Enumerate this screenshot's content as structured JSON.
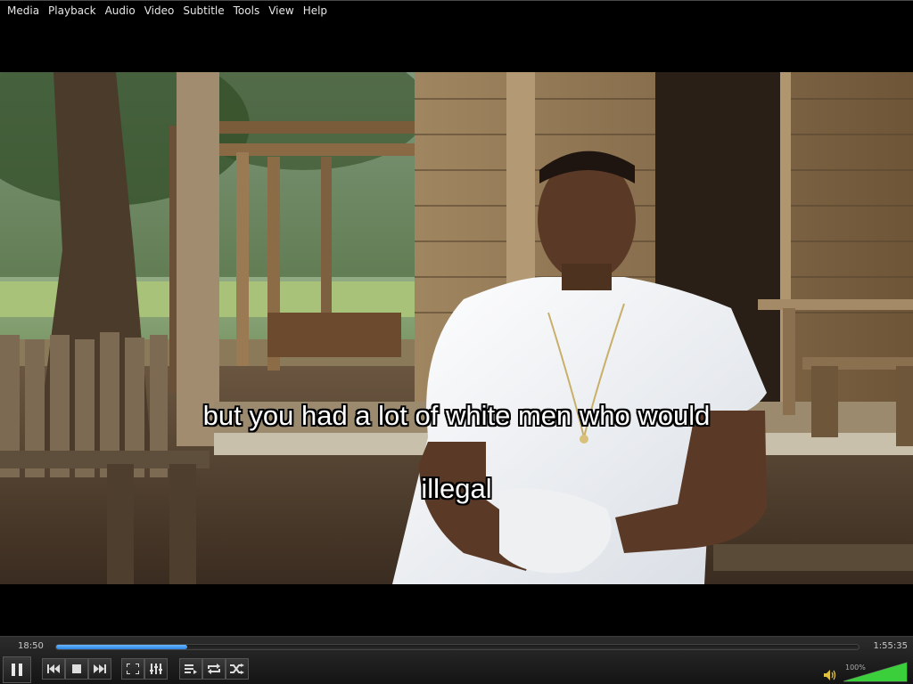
{
  "menu": [
    "Media",
    "Playback",
    "Audio",
    "Video",
    "Subtitle",
    "Tools",
    "View",
    "Help"
  ],
  "subtitles": {
    "line1": "but you had a lot of white men who would",
    "line2": "illegal"
  },
  "player": {
    "elapsed": "18:50",
    "total": "1:55:35",
    "progress": 0.163,
    "volume_label": "100%",
    "volume": 1.0
  },
  "icons": {
    "pause": "pause-icon",
    "prev": "previous-icon",
    "stop": "stop-icon",
    "next": "next-icon",
    "fullscreen": "fullscreen-icon",
    "settings": "extended-settings-icon",
    "playlist": "playlist-icon",
    "loop": "loop-icon",
    "shuffle": "shuffle-icon",
    "speaker": "speaker-icon"
  },
  "colors": {
    "seek_fill": "#2a85e0",
    "volume_fill": "#3ccf3c"
  }
}
